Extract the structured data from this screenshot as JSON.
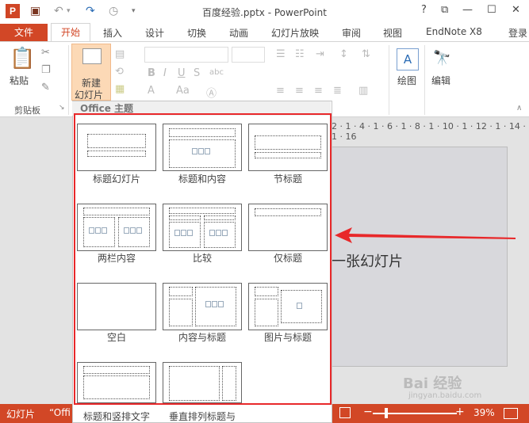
{
  "titlebar": {
    "app_icon": "P",
    "title": "百度经验.pptx - PowerPoint",
    "help": "?",
    "restore": "⧉",
    "minimize": "—",
    "maximize": "☐",
    "close": "✕"
  },
  "tabs": {
    "file": "文件",
    "home": "开始",
    "insert": "插入",
    "design": "设计",
    "transitions": "切换",
    "animations": "动画",
    "slideshow": "幻灯片放映",
    "review": "审阅",
    "view": "视图",
    "endnote": "EndNote X8",
    "login": "登录"
  },
  "ribbon": {
    "paste": "粘贴",
    "clipboard": "剪贴板",
    "new_slide_line1": "新建",
    "new_slide_line2": "幻灯片",
    "drawing": "绘图",
    "editing": "编辑"
  },
  "gallery": {
    "header": "Office 主题",
    "layouts": [
      "标题幻灯片",
      "标题和内容",
      "节标题",
      "两栏内容",
      "比较",
      "仅标题",
      "空白",
      "内容与标题",
      "图片与标题",
      "标题和竖排文字",
      "垂直排列标题与"
    ]
  },
  "ruler": "2 · 1 · 4 · 1 · 6 · 1 · 8 · 1 · 10 · 1 · 12 · 1 · 14 · 1 · 16",
  "slide": {
    "text": "一张幻灯片"
  },
  "status": {
    "left": "幻灯片",
    "office": "“Offi",
    "zoom": "39%"
  },
  "watermark": {
    "main": "Bai 经验",
    "sub": "jingyan.baidu.com"
  },
  "colors": {
    "accent": "#d24726",
    "highlight_box": "#e8282a"
  }
}
